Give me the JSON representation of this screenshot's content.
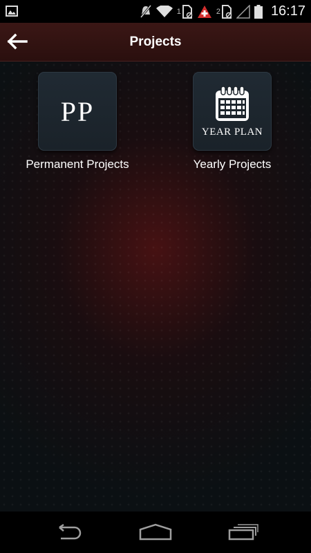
{
  "status_bar": {
    "time": "16:17",
    "sim1_label": "1",
    "sim2_label": "2",
    "icons": [
      "gallery-icon",
      "mute-icon",
      "wifi-icon",
      "sim1-icon",
      "alert-icon",
      "sim2-icon",
      "signal-icon",
      "battery-icon"
    ]
  },
  "action_bar": {
    "title": "Projects",
    "back_icon": "back-arrow-icon"
  },
  "tiles": [
    {
      "icon_text": "PP",
      "label": "Permanent Projects"
    },
    {
      "icon_text": "YEAR PLAN",
      "label": "Yearly Projects",
      "icon": "calendar-icon"
    }
  ],
  "nav_bar": {
    "icons": [
      "back-icon",
      "home-icon",
      "recent-apps-icon"
    ]
  },
  "colors": {
    "action_bar": "#3b1715",
    "background": "#0b1013",
    "tile": "#202a33",
    "alert": "#d32f2f"
  }
}
